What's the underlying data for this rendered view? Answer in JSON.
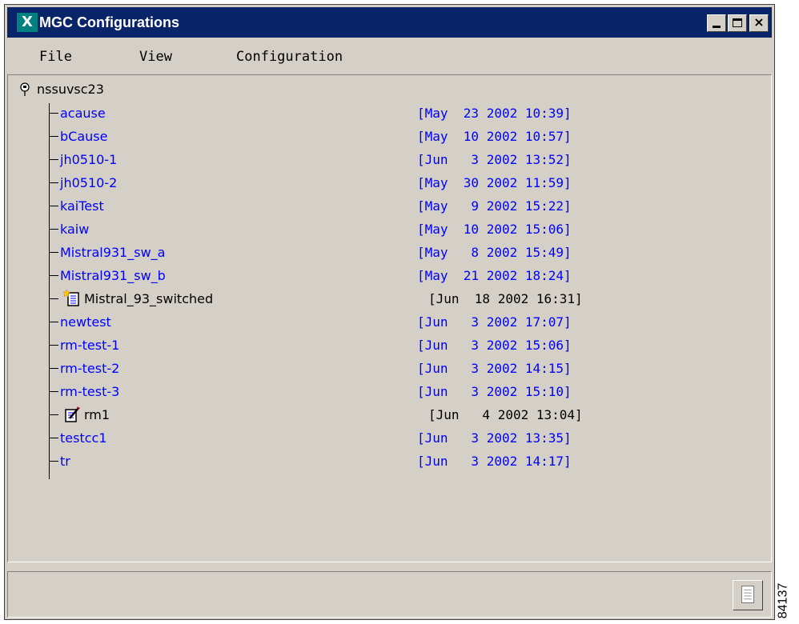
{
  "window": {
    "title": "MGC Configurations",
    "logo_letter": "X",
    "controls": {
      "minimize_icon": "minimize-icon",
      "maximize_icon": "maximize-icon",
      "close_icon": "close-icon",
      "close_glyph": "×"
    }
  },
  "menu": [
    "File",
    "View",
    "Configuration"
  ],
  "tree": {
    "root": {
      "label": "nssuvsc23",
      "icon": "server-icon"
    },
    "items": [
      {
        "name": "acause",
        "date": "[May  23 2002 10:39]"
      },
      {
        "name": "bCause",
        "date": "[May  10 2002 10:57]"
      },
      {
        "name": "jh0510-1",
        "date": "[Jun   3 2002 13:52]"
      },
      {
        "name": "jh0510-2",
        "date": "[May  30 2002 11:59]"
      },
      {
        "name": "kaiTest",
        "date": "[May   9 2002 15:22]"
      },
      {
        "name": "kaiw",
        "date": "[May  10 2002 15:06]"
      },
      {
        "name": "Mistral931_sw_a",
        "date": "[May   8 2002 15:49]"
      },
      {
        "name": "Mistral931_sw_b",
        "date": "[May  21 2002 18:24]"
      },
      {
        "name": "Mistral_93_switched",
        "date": "[Jun  18 2002 16:31]",
        "icon": "new-config-icon",
        "state": "active"
      },
      {
        "name": "newtest",
        "date": "[Jun   3 2002 17:07]"
      },
      {
        "name": "rm-test-1",
        "date": "[Jun   3 2002 15:06]"
      },
      {
        "name": "rm-test-2",
        "date": "[Jun   3 2002 14:15]"
      },
      {
        "name": "rm-test-3",
        "date": "[Jun   3 2002 15:10]"
      },
      {
        "name": "rm1",
        "date": "[Jun   4 2002 13:04]",
        "icon": "edit-config-icon",
        "state": "active"
      },
      {
        "name": "testcc1",
        "date": "[Jun   3 2002 13:35]"
      },
      {
        "name": "tr",
        "date": "[Jun   3 2002 14:17]"
      }
    ]
  },
  "status": {
    "text": "",
    "button_icon": "document-icon"
  },
  "figure_id": "84137",
  "colors": {
    "titlebar": "#0a246a",
    "link": "#0000ff",
    "chrome": "#d4d0c8"
  }
}
